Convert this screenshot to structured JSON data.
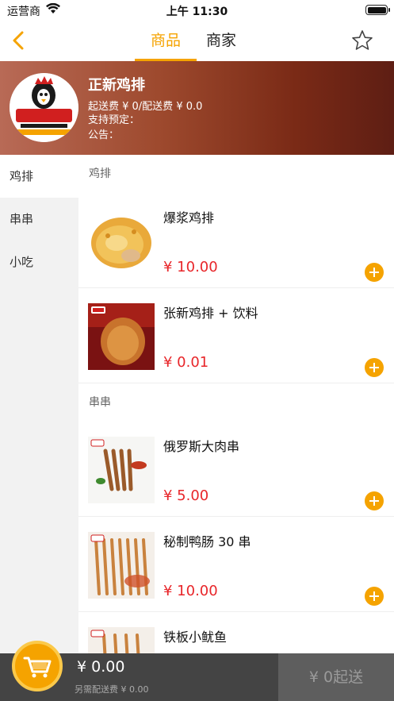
{
  "status_bar": {
    "carrier": "运营商",
    "time": "上午 11:30"
  },
  "nav": {
    "tabs": [
      {
        "label": "商品",
        "active": true
      },
      {
        "label": "商家",
        "active": false
      }
    ]
  },
  "shop": {
    "name": "正新鸡排",
    "delivery": "起送费 ¥ 0/配送费 ¥ 0.0",
    "reservation": "支持预定：",
    "notice": "公告："
  },
  "categories": [
    {
      "label": "鸡排",
      "active": true
    },
    {
      "label": "串串",
      "active": false
    },
    {
      "label": "小吃",
      "active": false
    }
  ],
  "sections": [
    {
      "title": "鸡排",
      "items": [
        {
          "name": "爆浆鸡排",
          "price": "¥ 10.00"
        },
        {
          "name": "张新鸡排 + 饮料",
          "price": "¥ 0.01"
        }
      ]
    },
    {
      "title": "串串",
      "items": [
        {
          "name": "俄罗斯大肉串",
          "price": "¥ 5.00"
        },
        {
          "name": "秘制鸭肠 30 串",
          "price": "¥ 10.00"
        },
        {
          "name": "铁板小鱿鱼",
          "price": ""
        }
      ]
    }
  ],
  "cart": {
    "total": "¥ 0.00",
    "delivery_note": "另需配送费 ¥ 0.00",
    "submit_label": "¥ 0起送"
  },
  "colors": {
    "accent": "#f5a300",
    "price": "#e8262a",
    "cart_bar": "#444444"
  }
}
